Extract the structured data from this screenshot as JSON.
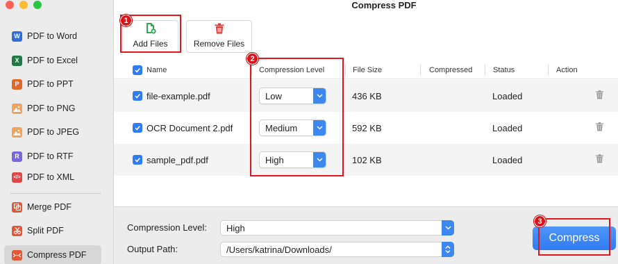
{
  "window": {
    "title": "Compress PDF"
  },
  "sidebar": {
    "items": [
      {
        "label": "PDF to Word",
        "icon": "word-icon",
        "icon_text": "W",
        "color": "#2f6fd6"
      },
      {
        "label": "PDF to Excel",
        "icon": "excel-icon",
        "icon_text": "X",
        "color": "#1f7a45"
      },
      {
        "label": "PDF to PPT",
        "icon": "ppt-icon",
        "icon_text": "P",
        "color": "#e0692a"
      },
      {
        "label": "PDF to PNG",
        "icon": "image-icon",
        "icon_text": "",
        "color": "#f0a35e"
      },
      {
        "label": "PDF to JPEG",
        "icon": "image-icon",
        "icon_text": "",
        "color": "#f0a35e"
      },
      {
        "label": "PDF to RTF",
        "icon": "rtf-icon",
        "icon_text": "R",
        "color": "#7a68d8"
      },
      {
        "label": "PDF to XML",
        "icon": "code-icon",
        "icon_text": "</>",
        "color": "#e04848"
      },
      {
        "label": "Merge PDF",
        "icon": "merge-icon",
        "icon_text": "",
        "color": "#e05a3a"
      },
      {
        "label": "Split PDF",
        "icon": "scissors-icon",
        "icon_text": "",
        "color": "#e05a3a"
      },
      {
        "label": "Compress PDF",
        "icon": "compress-icon",
        "icon_text": "",
        "color": "#e05a3a",
        "active": true
      }
    ]
  },
  "toolbar": {
    "add_label": "Add Files",
    "remove_label": "Remove Files"
  },
  "table": {
    "columns": [
      "Name",
      "Compression Level",
      "File Size",
      "Compressed",
      "Status",
      "Action"
    ],
    "rows": [
      {
        "name": "file-example.pdf",
        "level": "Low",
        "size": "436 KB",
        "compressed": "",
        "status": "Loaded"
      },
      {
        "name": "OCR Document 2.pdf",
        "level": "Medium",
        "size": "592 KB",
        "compressed": "",
        "status": "Loaded"
      },
      {
        "name": "sample_pdf.pdf",
        "level": "High",
        "size": "102 KB",
        "compressed": "",
        "status": "Loaded"
      }
    ]
  },
  "bottom": {
    "level_label": "Compression Level:",
    "level_value": "High",
    "path_label": "Output Path:",
    "path_value": "/Users/katrina/Downloads/",
    "compress_label": "Compress"
  },
  "annotations": [
    "1",
    "2",
    "3"
  ],
  "colors": {
    "accent": "#2f7cf6",
    "highlight": "#e0161c"
  }
}
